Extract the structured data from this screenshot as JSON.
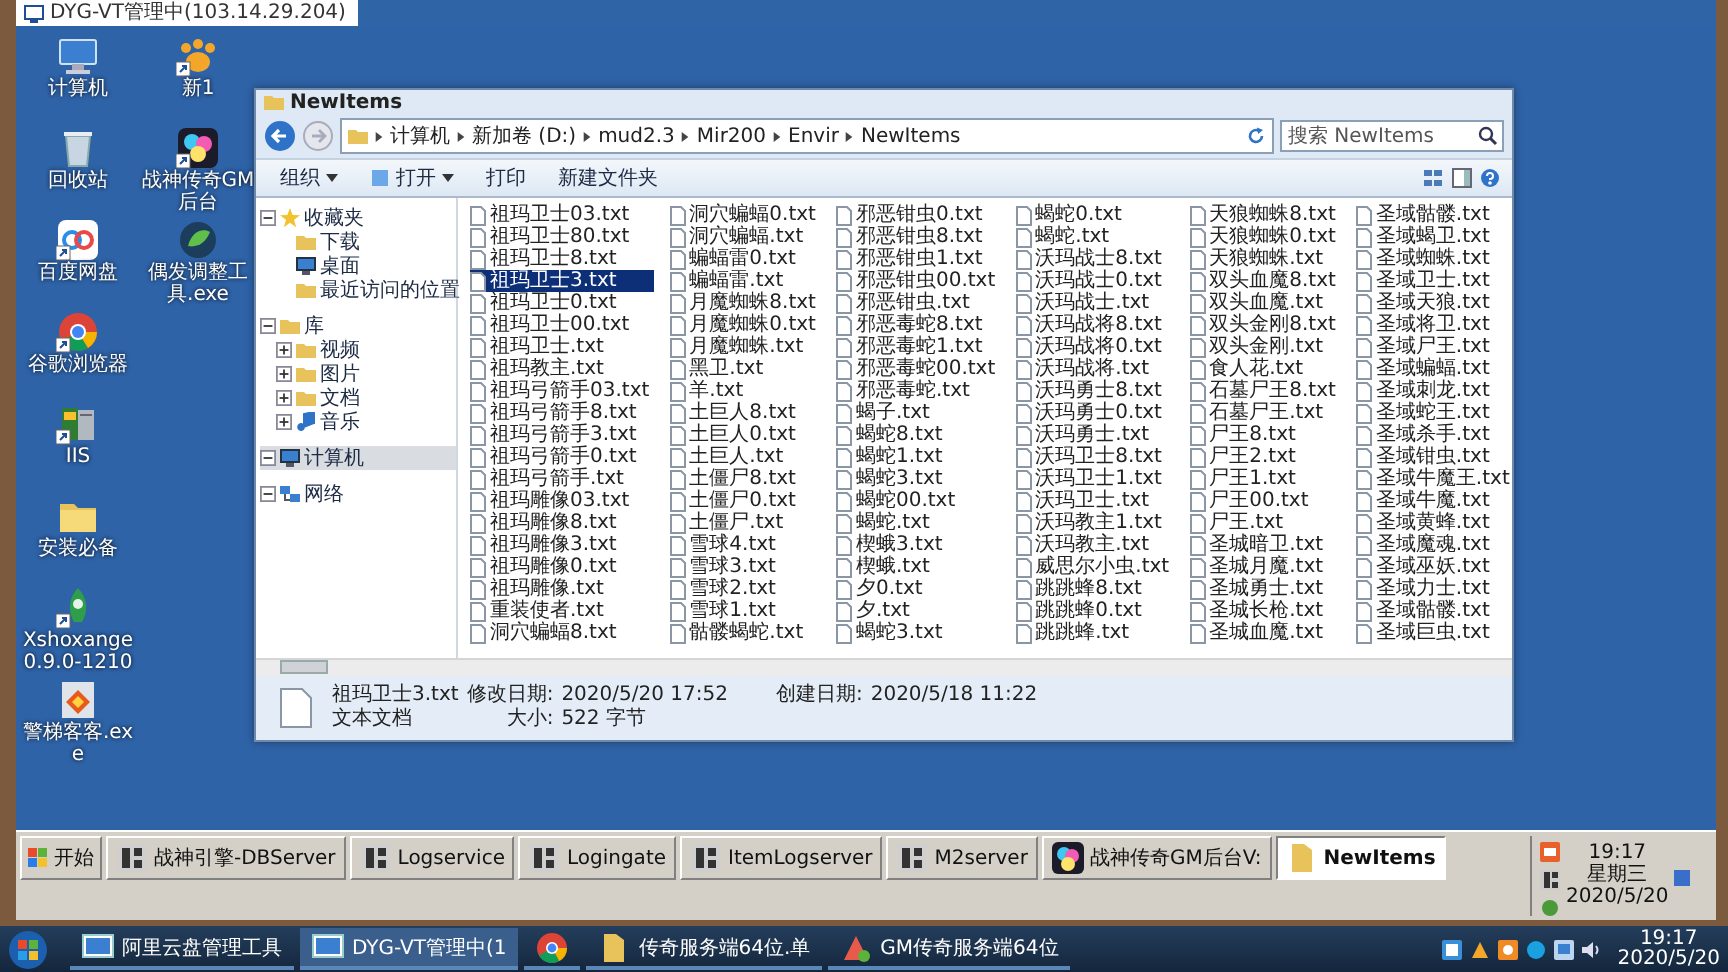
{
  "remote_session": {
    "title": "DYG-VT管理中(103.14.29.204)"
  },
  "desktop_icon_columns": [
    [
      {
        "label": "计算机",
        "kind": "computer",
        "shortcut": false
      },
      {
        "label": "回收站",
        "kind": "recycle",
        "shortcut": false
      },
      {
        "label": "百度网盘",
        "kind": "cloud",
        "shortcut": true
      },
      {
        "label": "谷歌浏览器",
        "kind": "chrome",
        "shortcut": true
      },
      {
        "label": "IIS",
        "kind": "server",
        "shortcut": true
      },
      {
        "label": "安装必备",
        "kind": "folder",
        "shortcut": false
      },
      {
        "label": "Xshoxange 0.9.0-1210",
        "kind": "rocket",
        "shortcut": true
      },
      {
        "label": "警梯客客.exe",
        "kind": "diamond",
        "shortcut": false
      }
    ],
    [
      {
        "label": "新1",
        "kind": "paw",
        "shortcut": true
      },
      {
        "label": "战神传奇GM后台",
        "kind": "palette",
        "shortcut": true
      },
      {
        "label": "偶发调整工具.exe",
        "kind": "globe",
        "shortcut": false
      }
    ]
  ],
  "explorer": {
    "title": "NewItems",
    "breadcrumb": [
      "计算机",
      "新加卷 (D:)",
      "mud2.3",
      "Mir200",
      "Envir",
      "NewItems"
    ],
    "search": {
      "placeholder": "搜索 NewItems"
    },
    "toolbar": [
      {
        "label": "组织",
        "dropdown": true
      },
      {
        "label": "打开",
        "dropdown": true
      },
      {
        "label": "打印",
        "dropdown": false
      },
      {
        "label": "新建文件夹",
        "dropdown": false
      }
    ],
    "nav": [
      {
        "label": "收藏夹",
        "kind": "star",
        "expanded": true,
        "selected": false,
        "children": [
          {
            "label": "下载",
            "kind": "folder",
            "selected": false
          },
          {
            "label": "桌面",
            "kind": "monitor",
            "selected": false
          },
          {
            "label": "最近访问的位置",
            "kind": "folder",
            "selected": false
          }
        ]
      },
      {
        "label": "库",
        "kind": "folder",
        "expanded": true,
        "selected": false,
        "children": [
          {
            "label": "视频",
            "kind": "folder",
            "expanded": false,
            "selected": false
          },
          {
            "label": "图片",
            "kind": "folder",
            "expanded": false,
            "selected": false
          },
          {
            "label": "文档",
            "kind": "folder",
            "expanded": false,
            "selected": false
          },
          {
            "label": "音乐",
            "kind": "music",
            "expanded": false,
            "selected": false
          }
        ]
      },
      {
        "label": "计算机",
        "kind": "monitor",
        "expanded": true,
        "selected": true
      },
      {
        "label": "网络",
        "kind": "network",
        "expanded": true,
        "selected": false
      }
    ],
    "file_columns": [
      [
        {
          "name": "祖玛卫士03.txt",
          "selected": false
        },
        {
          "name": "祖玛卫士80.txt",
          "selected": false
        },
        {
          "name": "祖玛卫士8.txt",
          "selected": false
        },
        {
          "name": "祖玛卫士3.txt",
          "selected": true
        },
        {
          "name": "祖玛卫士0.txt",
          "selected": false
        },
        {
          "name": "祖玛卫士00.txt",
          "selected": false
        },
        {
          "name": "祖玛卫士.txt",
          "selected": false
        },
        {
          "name": "祖玛教主.txt",
          "selected": false
        },
        {
          "name": "祖玛弓箭手03.txt",
          "selected": false
        },
        {
          "name": "祖玛弓箭手8.txt",
          "selected": false
        },
        {
          "name": "祖玛弓箭手3.txt",
          "selected": false
        },
        {
          "name": "祖玛弓箭手0.txt",
          "selected": false
        },
        {
          "name": "祖玛弓箭手.txt",
          "selected": false
        },
        {
          "name": "祖玛雕像03.txt",
          "selected": false
        },
        {
          "name": "祖玛雕像8.txt",
          "selected": false
        },
        {
          "name": "祖玛雕像3.txt",
          "selected": false
        },
        {
          "name": "祖玛雕像0.txt",
          "selected": false
        },
        {
          "name": "祖玛雕像.txt",
          "selected": false
        },
        {
          "name": "重装使者.txt",
          "selected": false
        },
        {
          "name": "洞穴蝙蝠8.txt",
          "selected": false
        }
      ],
      [
        {
          "name": "洞穴蝙蝠0.txt",
          "selected": false
        },
        {
          "name": "洞穴蝙蝠.txt",
          "selected": false
        },
        {
          "name": "蝙蝠雷0.txt",
          "selected": false
        },
        {
          "name": "蝙蝠雷.txt",
          "selected": false
        },
        {
          "name": "月魔蜘蛛8.txt",
          "selected": false
        },
        {
          "name": "月魔蜘蛛0.txt",
          "selected": false
        },
        {
          "name": "月魔蜘蛛.txt",
          "selected": false
        },
        {
          "name": "黑卫.txt",
          "selected": false
        },
        {
          "name": "羊.txt",
          "selected": false
        },
        {
          "name": "土巨人8.txt",
          "selected": false
        },
        {
          "name": "土巨人0.txt",
          "selected": false
        },
        {
          "name": "土巨人.txt",
          "selected": false
        },
        {
          "name": "土僵尸8.txt",
          "selected": false
        },
        {
          "name": "土僵尸0.txt",
          "selected": false
        },
        {
          "name": "土僵尸.txt",
          "selected": false
        },
        {
          "name": "雪球4.txt",
          "selected": false
        },
        {
          "name": "雪球3.txt",
          "selected": false
        },
        {
          "name": "雪球2.txt",
          "selected": false
        },
        {
          "name": "雪球1.txt",
          "selected": false
        },
        {
          "name": "骷髅蝎蛇.txt",
          "selected": false
        }
      ],
      [
        {
          "name": "邪恶钳虫0.txt",
          "selected": false
        },
        {
          "name": "邪恶钳虫8.txt",
          "selected": false
        },
        {
          "name": "邪恶钳虫1.txt",
          "selected": false
        },
        {
          "name": "邪恶钳虫00.txt",
          "selected": false
        },
        {
          "name": "邪恶钳虫.txt",
          "selected": false
        },
        {
          "name": "邪恶毒蛇8.txt",
          "selected": false
        },
        {
          "name": "邪恶毒蛇1.txt",
          "selected": false
        },
        {
          "name": "邪恶毒蛇00.txt",
          "selected": false
        },
        {
          "name": "邪恶毒蛇.txt",
          "selected": false
        },
        {
          "name": "蝎子.txt",
          "selected": false
        },
        {
          "name": "蝎蛇8.txt",
          "selected": false
        },
        {
          "name": "蝎蛇1.txt",
          "selected": false
        },
        {
          "name": "蝎蛇3.txt",
          "selected": false
        },
        {
          "name": "蝎蛇00.txt",
          "selected": false
        },
        {
          "name": "蝎蛇.txt",
          "selected": false
        },
        {
          "name": "楔蛾3.txt",
          "selected": false
        },
        {
          "name": "楔蛾.txt",
          "selected": false
        },
        {
          "name": "夕0.txt",
          "selected": false
        },
        {
          "name": "夕.txt",
          "selected": false
        },
        {
          "name": "蝎蛇3.txt",
          "selected": false
        }
      ],
      [
        {
          "name": "蝎蛇0.txt",
          "selected": false
        },
        {
          "name": "蝎蛇.txt",
          "selected": false
        },
        {
          "name": "沃玛战士8.txt",
          "selected": false
        },
        {
          "name": "沃玛战士0.txt",
          "selected": false
        },
        {
          "name": "沃玛战士.txt",
          "selected": false
        },
        {
          "name": "沃玛战将8.txt",
          "selected": false
        },
        {
          "name": "沃玛战将0.txt",
          "selected": false
        },
        {
          "name": "沃玛战将.txt",
          "selected": false
        },
        {
          "name": "沃玛勇士8.txt",
          "selected": false
        },
        {
          "name": "沃玛勇士0.txt",
          "selected": false
        },
        {
          "name": "沃玛勇士.txt",
          "selected": false
        },
        {
          "name": "沃玛卫士8.txt",
          "selected": false
        },
        {
          "name": "沃玛卫士1.txt",
          "selected": false
        },
        {
          "name": "沃玛卫士.txt",
          "selected": false
        },
        {
          "name": "沃玛教主1.txt",
          "selected": false
        },
        {
          "name": "沃玛教主.txt",
          "selected": false
        },
        {
          "name": "威思尔小虫.txt",
          "selected": false
        },
        {
          "name": "跳跳蜂8.txt",
          "selected": false
        },
        {
          "name": "跳跳蜂0.txt",
          "selected": false
        },
        {
          "name": "跳跳蜂.txt",
          "selected": false
        }
      ],
      [
        {
          "name": "天狼蜘蛛8.txt",
          "selected": false
        },
        {
          "name": "天狼蜘蛛0.txt",
          "selected": false
        },
        {
          "name": "天狼蜘蛛.txt",
          "selected": false
        },
        {
          "name": "双头血魔8.txt",
          "selected": false
        },
        {
          "name": "双头血魔.txt",
          "selected": false
        },
        {
          "name": "双头金刚8.txt",
          "selected": false
        },
        {
          "name": "双头金刚.txt",
          "selected": false
        },
        {
          "name": "食人花.txt",
          "selected": false
        },
        {
          "name": "石墓尸王8.txt",
          "selected": false
        },
        {
          "name": "石墓尸王.txt",
          "selected": false
        },
        {
          "name": "尸王8.txt",
          "selected": false
        },
        {
          "name": "尸王2.txt",
          "selected": false
        },
        {
          "name": "尸王1.txt",
          "selected": false
        },
        {
          "name": "尸王00.txt",
          "selected": false
        },
        {
          "name": "尸王.txt",
          "selected": false
        },
        {
          "name": "圣城暗卫.txt",
          "selected": false
        },
        {
          "name": "圣城月魔.txt",
          "selected": false
        },
        {
          "name": "圣城勇士.txt",
          "selected": false
        },
        {
          "name": "圣城长枪.txt",
          "selected": false
        },
        {
          "name": "圣城血魔.txt",
          "selected": false
        }
      ],
      [
        {
          "name": "圣域骷髅.txt",
          "selected": false
        },
        {
          "name": "圣域蝎卫.txt",
          "selected": false
        },
        {
          "name": "圣域蜘蛛.txt",
          "selected": false
        },
        {
          "name": "圣域卫士.txt",
          "selected": false
        },
        {
          "name": "圣域天狼.txt",
          "selected": false
        },
        {
          "name": "圣域将卫.txt",
          "selected": false
        },
        {
          "name": "圣域尸王.txt",
          "selected": false
        },
        {
          "name": "圣域蝙蝠.txt",
          "selected": false
        },
        {
          "name": "圣域刺龙.txt",
          "selected": false
        },
        {
          "name": "圣域蛇王.txt",
          "selected": false
        },
        {
          "name": "圣域杀手.txt",
          "selected": false
        },
        {
          "name": "圣域钳虫.txt",
          "selected": false
        },
        {
          "name": "圣域牛魔王.txt",
          "selected": false
        },
        {
          "name": "圣域牛魔.txt",
          "selected": false
        },
        {
          "name": "圣域黄蜂.txt",
          "selected": false
        },
        {
          "name": "圣域魔魂.txt",
          "selected": false
        },
        {
          "name": "圣域巫妖.txt",
          "selected": false
        },
        {
          "name": "圣域力士.txt",
          "selected": false
        },
        {
          "name": "圣域骷髅.txt",
          "selected": false
        },
        {
          "name": "圣域巨虫.txt",
          "selected": false
        }
      ]
    ],
    "details": {
      "name": "祖玛卫士3.txt",
      "modified_label": "修改日期:",
      "modified": "2020/5/20 17:52",
      "created_label": "创建日期:",
      "created": "2020/5/18 11:22",
      "type": "文本文档",
      "size_label": "大小:",
      "size": "522 字节"
    }
  },
  "remote_taskbar": {
    "start": "开始",
    "buttons": [
      {
        "label": "战神引擎-DBServer",
        "kind": "engine",
        "selected": false
      },
      {
        "label": "Logservice",
        "kind": "engine",
        "selected": false
      },
      {
        "label": "Logingate",
        "kind": "engine",
        "selected": false
      },
      {
        "label": "ItemLogserver",
        "kind": "engine",
        "selected": false
      },
      {
        "label": "M2server",
        "kind": "engine",
        "selected": false
      },
      {
        "label": "战神传奇GM后台V:",
        "kind": "palette",
        "selected": false
      },
      {
        "label": "NewItems",
        "kind": "folder",
        "selected": true
      }
    ],
    "time": "19:17",
    "weekday": "星期三",
    "date": "2020/5/20"
  },
  "host_taskbar": {
    "buttons": [
      {
        "label": "阿里云盘管理工具",
        "kind": "monitor",
        "selected": false
      },
      {
        "label": "DYG-VT管理中(1",
        "kind": "monitor",
        "selected": true
      },
      {
        "kind": "chrome",
        "selected": false
      },
      {
        "label": "传奇服务端64位.单",
        "kind": "folder",
        "selected": false
      },
      {
        "label": "GM传奇服务端64位",
        "kind": "tool",
        "selected": false
      }
    ],
    "time": "19:17",
    "date": "2020/5/20"
  }
}
